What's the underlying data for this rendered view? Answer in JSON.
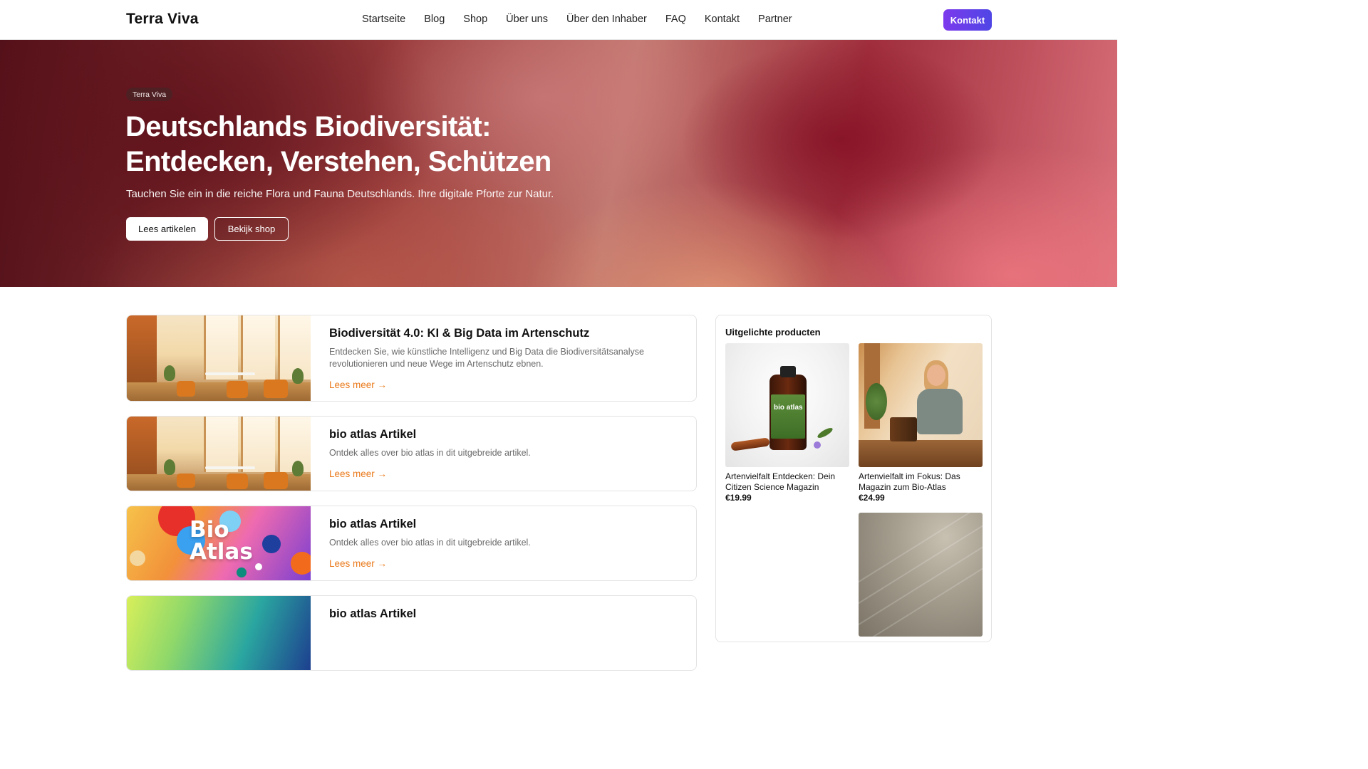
{
  "header": {
    "logo": "Terra Viva",
    "nav": [
      "Startseite",
      "Blog",
      "Shop",
      "Über uns",
      "Über den Inhaber",
      "FAQ",
      "Kontakt",
      "Partner"
    ],
    "cta": "Kontakt"
  },
  "hero": {
    "tag": "Terra Viva",
    "title_line1": "Deutschlands Biodiversität:",
    "title_line2": "Entdecken, Verstehen, Schützen",
    "subtitle": "Tauchen Sie ein in die reiche Flora und Fauna Deutschlands. Ihre digitale Pforte zur Natur.",
    "primary_button": "Lees artikelen",
    "secondary_button": "Bekijk shop"
  },
  "articles": [
    {
      "title": "Biodiversität 4.0: KI & Big Data im Artenschutz",
      "description": "Entdecken Sie, wie künstliche Intelligenz und Big Data die Biodiversitätsanalyse revolutionieren und neue Wege im Artenschutz ebnen.",
      "link": "Lees meer →"
    },
    {
      "title": "bio atlas Artikel",
      "description": "Ontdek alles over bio atlas in dit uitgebreide artikel.",
      "link": "Lees meer →"
    },
    {
      "title": "bio atlas Artikel",
      "description": "Ontdek alles over bio atlas in dit uitgebreide artikel.",
      "link": "Lees meer →",
      "image_text_line1": "Bio",
      "image_text_line2": "Atlas"
    },
    {
      "title": "bio atlas Artikel"
    }
  ],
  "sidebar": {
    "title": "Uitgelichte producten",
    "products": [
      {
        "name": "Artenvielfalt Entdecken: Dein Citizen Science Magazin",
        "price": "€19.99",
        "label_text": "bio atlas"
      },
      {
        "name": "Artenvielfalt im Fokus: Das Magazin zum Bio-Atlas",
        "price": "€24.99"
      }
    ]
  }
}
